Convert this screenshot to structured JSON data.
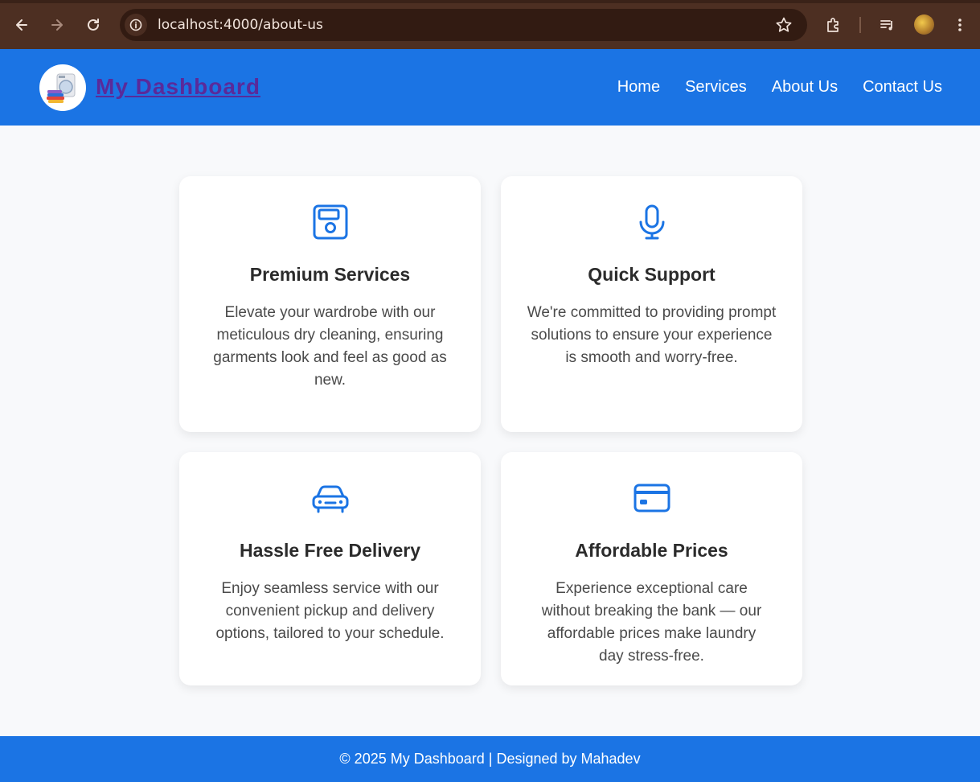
{
  "browser": {
    "url": "localhost:4000/about-us",
    "icons": [
      "back-icon",
      "forward-icon",
      "reload-icon",
      "info-icon",
      "star-icon",
      "extensions-icon",
      "media-icon",
      "profile-avatar",
      "menu-icon"
    ]
  },
  "header": {
    "brand": "My Dashboard",
    "nav": [
      "Home",
      "Services",
      "About Us",
      "Contact Us"
    ]
  },
  "features": [
    {
      "icon": "floppy-disk-icon",
      "title": "Premium Services",
      "text": "Elevate your wardrobe with our meticulous dry cleaning, ensuring garments look and feel as good as new."
    },
    {
      "icon": "microphone-icon",
      "title": "Quick Support",
      "text": "We're committed to providing prompt solutions to ensure your experience is smooth and worry-free."
    },
    {
      "icon": "car-icon",
      "title": "Hassle Free Delivery",
      "text": "Enjoy seamless service with our convenient pickup and delivery options, tailored to your schedule."
    },
    {
      "icon": "credit-card-icon",
      "title": "Affordable Prices",
      "text": "Experience exceptional care without breaking the bank — our affordable prices make laundry day stress-free."
    }
  ],
  "footer": {
    "text": "© 2025 My Dashboard | Designed by Mahadev"
  },
  "colors": {
    "primary": "#1b74e4",
    "brand_link": "#5a2a9a",
    "chrome": "#4d2f22"
  }
}
